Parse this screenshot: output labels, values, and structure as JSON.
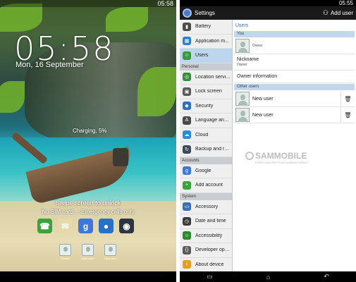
{
  "lock_screen": {
    "status_time": "05:58",
    "clock": "05:58",
    "date": "Mon, 16 September",
    "charging": "Charging, 5%",
    "swipe_hint": "Swipe screen to unlock",
    "sim_status": "No SIM card. – Emergency calls only",
    "apps": [
      {
        "name": "phone-icon",
        "color": "#3aa43a",
        "glyph": "☎"
      },
      {
        "name": "email-icon",
        "color": "#e8d9a8",
        "glyph": "✉"
      },
      {
        "name": "google-icon",
        "color": "#3c78d8",
        "glyph": "g"
      },
      {
        "name": "internet-icon",
        "color": "#2a6fc9",
        "glyph": "●"
      },
      {
        "name": "camera-icon",
        "color": "#2b3640",
        "glyph": "◉"
      }
    ],
    "users": [
      "Owner",
      "New user",
      "New user"
    ]
  },
  "settings": {
    "status_time": "05:55",
    "title": "Settings",
    "add_user": "Add user",
    "left_menu": [
      {
        "type": "item",
        "label": "Battery",
        "icon": "battery-icon",
        "color": "#4b4b4b",
        "glyph": "▮"
      },
      {
        "type": "item",
        "label": "Application m...",
        "icon": "apps-icon",
        "color": "#2d7dd2",
        "glyph": "▦"
      },
      {
        "type": "item",
        "label": "Users",
        "icon": "users-icon",
        "color": "#3a9a3a",
        "glyph": "☺",
        "selected": true
      },
      {
        "type": "category",
        "label": "Personal"
      },
      {
        "type": "item",
        "label": "Location servi...",
        "icon": "location-icon",
        "color": "#3a8c3a",
        "glyph": "◎"
      },
      {
        "type": "item",
        "label": "Lock screen",
        "icon": "lock-icon",
        "color": "#5a5a5a",
        "glyph": "▣"
      },
      {
        "type": "item",
        "label": "Security",
        "icon": "security-icon",
        "color": "#2d6fc0",
        "glyph": "◆"
      },
      {
        "type": "item",
        "label": "Language and...",
        "icon": "language-icon",
        "color": "#4a4a4a",
        "glyph": "A"
      },
      {
        "type": "item",
        "label": "Cloud",
        "icon": "cloud-icon",
        "color": "#2a8cd8",
        "glyph": "☁"
      },
      {
        "type": "item",
        "label": "Backup and re...",
        "icon": "backup-icon",
        "color": "#3d4a5a",
        "glyph": "↻"
      },
      {
        "type": "category",
        "label": "Accounts"
      },
      {
        "type": "item",
        "label": "Google",
        "icon": "google-icon",
        "color": "#3c78d8",
        "glyph": "g"
      },
      {
        "type": "item",
        "label": "Add account",
        "icon": "add-account-icon",
        "color": "#3aa43a",
        "glyph": "+"
      },
      {
        "type": "category",
        "label": "System"
      },
      {
        "type": "item",
        "label": "Accessory",
        "icon": "accessory-icon",
        "color": "#3b6fb0",
        "glyph": "▭"
      },
      {
        "type": "item",
        "label": "Date and time",
        "icon": "clock-icon",
        "color": "#3a3a3a",
        "glyph": "◷"
      },
      {
        "type": "item",
        "label": "Accessibility",
        "icon": "accessibility-icon",
        "color": "#2e8a2e",
        "glyph": "☺"
      },
      {
        "type": "item",
        "label": "Developer opti...",
        "icon": "developer-icon",
        "color": "#5a5a5a",
        "glyph": "{}"
      },
      {
        "type": "item",
        "label": "About device",
        "icon": "about-icon",
        "color": "#e0a020",
        "glyph": "i"
      }
    ],
    "users_panel": {
      "title": "Users",
      "you_section": "You",
      "owner_label": "Owner",
      "nickname_label": "Nickname",
      "nickname_value": "Owner",
      "owner_info": "Owner information",
      "other_section": "Other users",
      "other_users": [
        "New user",
        "New user"
      ]
    },
    "watermark": {
      "brand": "SAMMOBILE",
      "tagline": "EVERYTHING FOR YOUR SAMSUNG MOBILE"
    }
  }
}
